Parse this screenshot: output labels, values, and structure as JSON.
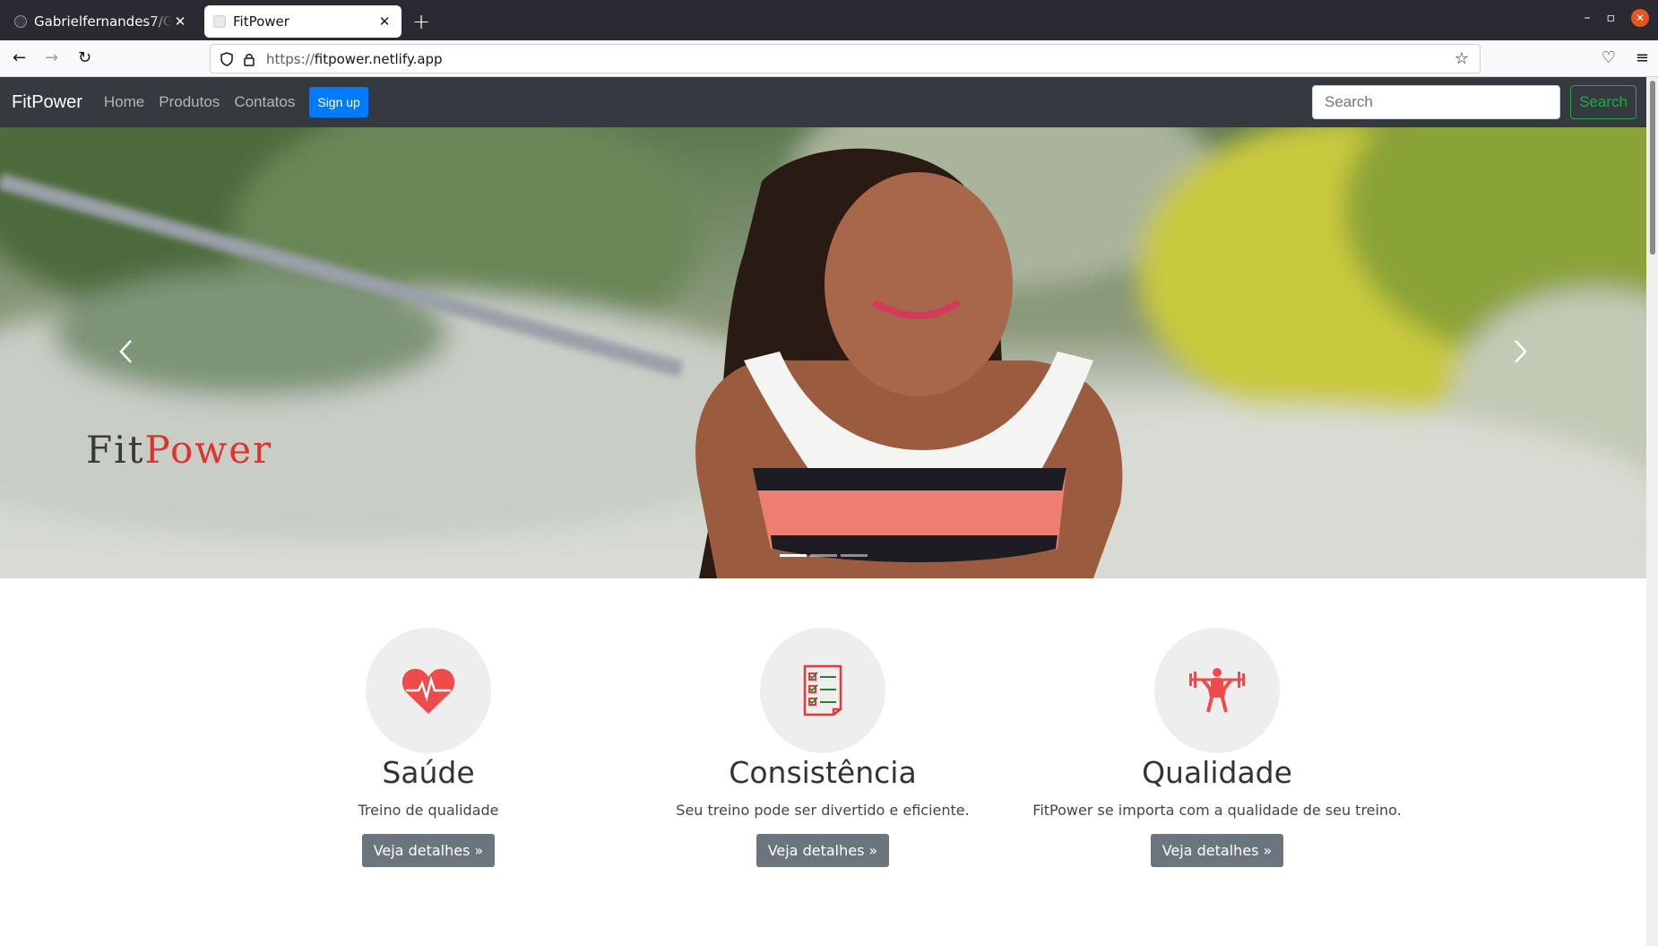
{
  "browser": {
    "tabs": [
      {
        "title": "Gabrielfernandes7/Gabrie",
        "active": false
      },
      {
        "title": "FitPower",
        "active": true
      }
    ],
    "url_prefix": "https://",
    "url_domain": "fitpower.netlify.app"
  },
  "site": {
    "brand": "FitPower",
    "nav": [
      "Home",
      "Produtos",
      "Contatos"
    ],
    "signup_label": "Sign up",
    "search_placeholder": "Search",
    "search_button": "Search"
  },
  "carousel": {
    "slide_count": 3,
    "active_index": 0,
    "logo_fit": "Fit",
    "logo_power": "Power"
  },
  "features": [
    {
      "icon": "heart-pulse-icon",
      "title": "Saúde",
      "text": "Treino de qualidade",
      "button": "Veja detalhes »"
    },
    {
      "icon": "checklist-icon",
      "title": "Consistência",
      "text": "Seu treino pode ser divertido e eficiente.",
      "button": "Veja detalhes »"
    },
    {
      "icon": "weightlifter-icon",
      "title": "Qualidade",
      "text": "FitPower se importa com a qualidade de seu treino.",
      "button": "Veja detalhes »"
    }
  ],
  "colors": {
    "navbar_bg": "#343a40",
    "primary": "#007bff",
    "success": "#28a745",
    "secondary": "#6c757d",
    "icon_red": "#ef4b4b"
  }
}
